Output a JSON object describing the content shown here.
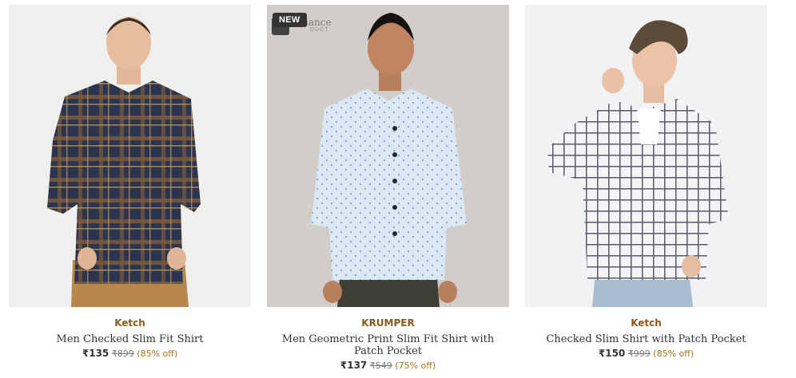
{
  "products": [
    {
      "brand": "Ketch",
      "name": "Men Checked Slim Fit Shirt",
      "price": "₹135",
      "mrp": "₹899",
      "discount": "(85% off)",
      "image_icon": "shirt-photo",
      "badge": ""
    },
    {
      "brand": "KRUMPER",
      "name": "Men Geometric Print Slim Fit Shirt with Patch Pocket",
      "price": "₹137",
      "mrp": "₹549",
      "discount": "(75% off)",
      "image_icon": "shirt-photo",
      "badge": "NEW",
      "watermark": "iance",
      "watermark_sub": "DUCT"
    },
    {
      "brand": "Ketch",
      "name": "Checked Slim Shirt with Patch Pocket",
      "price": "₹150",
      "mrp": "₹999",
      "discount": "(85% off)",
      "image_icon": "shirt-photo",
      "badge": ""
    }
  ],
  "colors": {
    "brand": "#8a5a1c",
    "discount": "#a8741e",
    "badge_bg": "#333333"
  }
}
